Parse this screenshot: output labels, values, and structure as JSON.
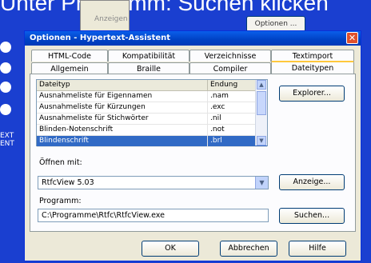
{
  "desktop": {
    "title_text": "Unter Programm: Suchen klicken",
    "bg_window_label": "Anzeigen",
    "bg_button_label": "Optionen ...",
    "side_text_line1": "EXT",
    "side_text_line2": "ENT"
  },
  "dialog": {
    "title": "Optionen - Hypertext-Assistent",
    "close_label": "✕",
    "tabs_row1": [
      "HTML-Code",
      "Kompatibilität",
      "Verzeichnisse",
      "Textimport"
    ],
    "tabs_row2": [
      "Allgemein",
      "Braille",
      "Compiler",
      "Dateitypen"
    ],
    "active_tab": "Dateitypen"
  },
  "filetypes": {
    "columns": [
      "Dateityp",
      "Endung"
    ],
    "rows": [
      {
        "type": "Ausnahmeliste für Eigennamen",
        "ext": ".nam"
      },
      {
        "type": "Ausnahmeliste für Kürzungen",
        "ext": ".exc"
      },
      {
        "type": "Ausnahmeliste für Stichwörter",
        "ext": ".nil"
      },
      {
        "type": "Blinden-Notenschrift",
        "ext": ".not"
      },
      {
        "type": "Blindenschrift",
        "ext": ".brl"
      }
    ],
    "selected_index": 4
  },
  "buttons": {
    "explorer": "Explorer...",
    "anzeige": "Anzeige...",
    "suchen": "Suchen...",
    "ok": "OK",
    "abbrechen": "Abbrechen",
    "hilfe": "Hilfe"
  },
  "open_with": {
    "label": "Öffnen mit:",
    "value": "RtfcView 5.03"
  },
  "program": {
    "label": "Programm:",
    "value": "C:\\Programme\\Rtfc\\RtfcView.exe"
  }
}
